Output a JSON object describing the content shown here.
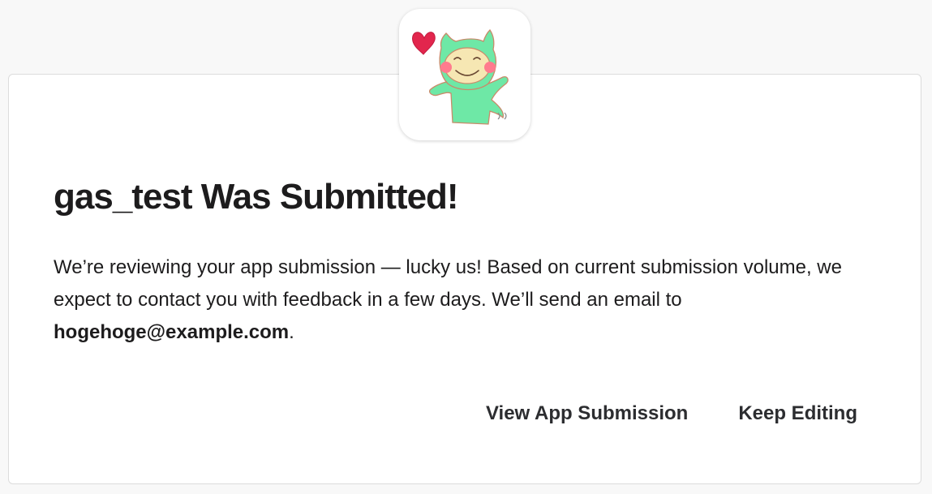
{
  "app": {
    "icon_name": "app-mascot-icon"
  },
  "dialog": {
    "title": "gas_test Was Submitted!",
    "body_lead": "We’re reviewing your app submission — lucky us! Based on current submission volume, we expect to contact you with feedback in a few days. We’ll send an email to ",
    "email": "hogehoge@example.com",
    "body_tail": "."
  },
  "actions": {
    "view_submission_label": "View App Submission",
    "keep_editing_label": "Keep Editing"
  },
  "colors": {
    "background": "#f8f8f8",
    "card": "#ffffff",
    "text": "#1d1c1d",
    "button_text": "#2c2d30",
    "mascot_green": "#6ee8a6",
    "heart_red": "#e2264d"
  }
}
